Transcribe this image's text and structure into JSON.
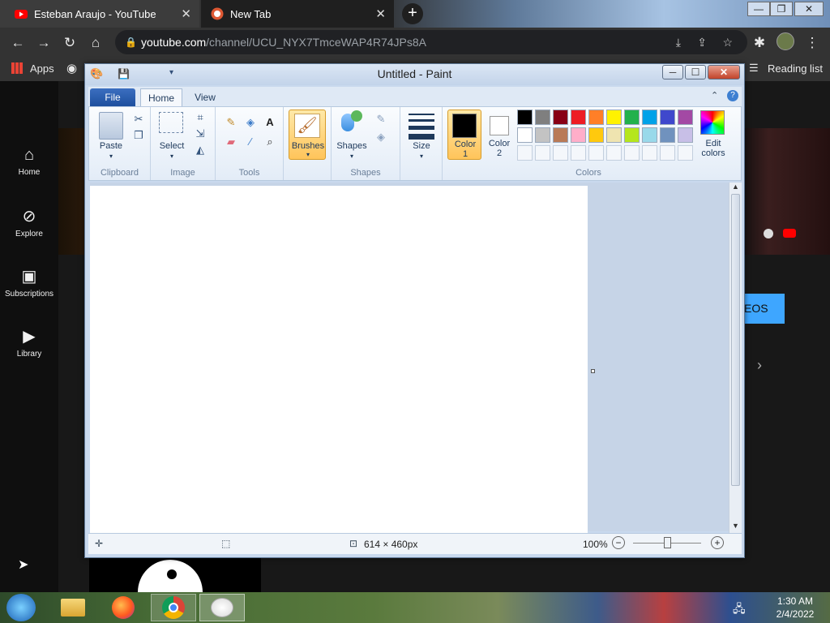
{
  "browser": {
    "tabs": [
      {
        "title": "Esteban Araujo - YouTube"
      },
      {
        "title": "New Tab"
      }
    ],
    "new_tab_symbol": "+",
    "url_host": "youtube.com",
    "url_path": "/channel/UCU_NYX7TmceWAP4R74JPs8A",
    "bookmarks": {
      "apps_label": "Apps",
      "reading_list_label": "Reading list"
    }
  },
  "youtube": {
    "sidebar": [
      {
        "label": "Home"
      },
      {
        "label": "Explore"
      },
      {
        "label": "Subscriptions"
      },
      {
        "label": "Library"
      }
    ],
    "videos_button_partial": "EOS"
  },
  "paint": {
    "window_title": "Untitled - Paint",
    "ribbon_tabs": [
      "File",
      "Home",
      "View"
    ],
    "groups": {
      "clipboard": {
        "label": "Clipboard",
        "paste": "Paste"
      },
      "image": {
        "label": "Image",
        "select": "Select"
      },
      "tools": {
        "label": "Tools"
      },
      "brushes": {
        "label": "Brushes"
      },
      "shapes": {
        "label": "Shapes",
        "shapes_btn": "Shapes"
      },
      "size": {
        "label": "Size"
      },
      "colors": {
        "label": "Colors",
        "color1": "Color",
        "color1_num": "1",
        "color2": "Color",
        "color2_num": "2",
        "edit": "Edit",
        "edit2": "colors"
      }
    },
    "palette_row1": [
      "#000000",
      "#7f7f7f",
      "#880015",
      "#ed1c24",
      "#ff7f27",
      "#fff200",
      "#22b14c",
      "#00a2e8",
      "#3f48cc",
      "#a349a4"
    ],
    "palette_row2": [
      "#ffffff",
      "#c3c3c3",
      "#b97a57",
      "#ffaec9",
      "#ffc90e",
      "#efe4b0",
      "#b5e61d",
      "#99d9ea",
      "#7092be",
      "#c8bfe7"
    ],
    "color1_value": "#000000",
    "color2_value": "#ffffff",
    "status": {
      "canvas_size": "614 × 460px",
      "zoom": "100%"
    }
  },
  "taskbar": {
    "time": "1:30 AM",
    "date": "2/4/2022"
  }
}
